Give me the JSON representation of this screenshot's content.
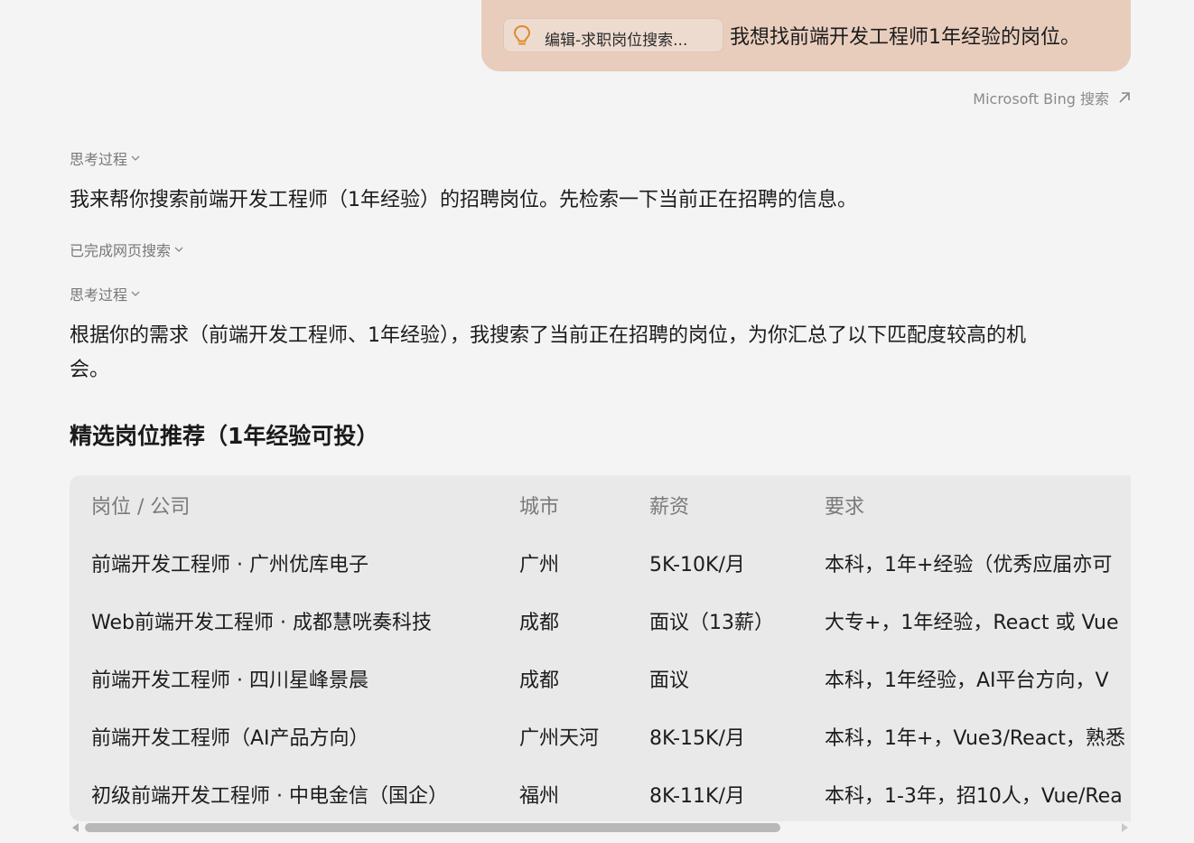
{
  "user_message": {
    "attachment_label": "编辑-求职岗位搜索...",
    "text": "我想找前端开发工程师1年经验的岗位。"
  },
  "bing_link": "Microsoft Bing 搜索",
  "thinking_label_1": "思考过程",
  "intro_text": "我来帮你搜索前端开发工程师（1年经验）的招聘岗位。先检索一下当前正在招聘的信息。",
  "search_done_label": "已完成网页搜索",
  "thinking_label_2": "思考过程",
  "summary_line1": "根据你的需求（前端开发工程师、1年经验），我搜索了当前正在招聘的岗位，为你汇总了以下匹配度较高的机",
  "summary_line2": "会。",
  "section_heading": "精选岗位推荐（1年经验可投）",
  "table": {
    "headers": [
      "岗位 / 公司",
      "城市",
      "薪资",
      "要求"
    ],
    "rows": [
      [
        "前端开发工程师 · 广州优库电子",
        "广州",
        "5K-10K/月",
        "本科，1年+经验（优秀应届亦可"
      ],
      [
        "Web前端开发工程师 · 成都慧咣奏科技",
        "成都",
        "面议（13薪）",
        "大专+，1年经验，React 或 Vue"
      ],
      [
        "前端开发工程师 · 四川星峰景晨",
        "成都",
        "面议",
        "本科，1年经验，AI平台方向，V"
      ],
      [
        "前端开发工程师（AI产品方向）",
        "广州天河",
        "8K-15K/月",
        "本科，1年+，Vue3/React，熟悉"
      ],
      [
        "初级前端开发工程师 · 中电金信（国企）",
        "福州",
        "8K-11K/月",
        "本科，1-3年，招10人，Vue/Rea"
      ]
    ]
  }
}
